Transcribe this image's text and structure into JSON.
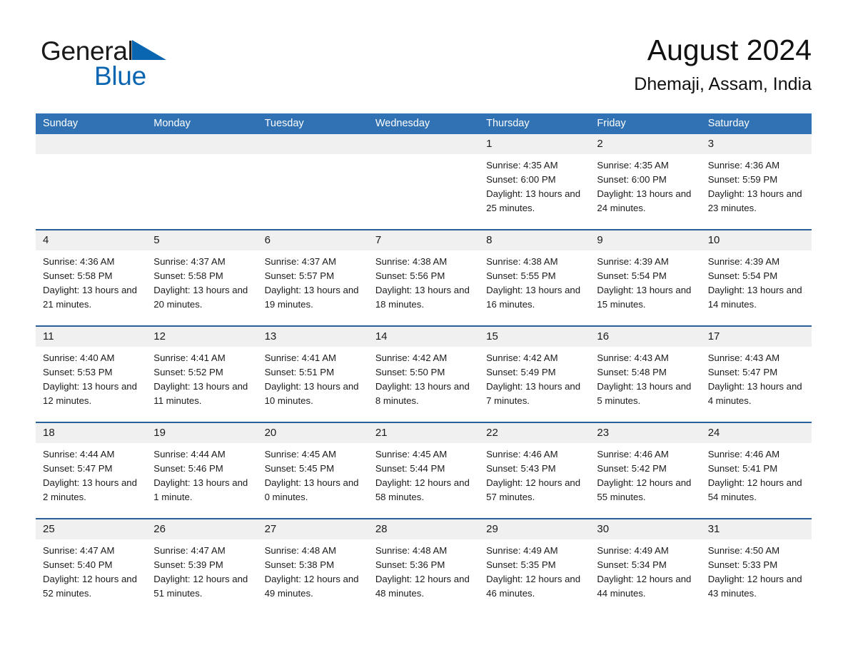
{
  "brand": {
    "word1": "General",
    "word2": "Blue",
    "triangle_color": "#0b66b2"
  },
  "header": {
    "title": "August 2024",
    "location": "Dhemaji, Assam, India"
  },
  "theme": {
    "header_blue": "#3072b3",
    "row_divider_blue": "#2a6099",
    "day_band_gray": "#f0f0f0",
    "text_color": "#1b1b1b"
  },
  "weekday_headers": [
    "Sunday",
    "Monday",
    "Tuesday",
    "Wednesday",
    "Thursday",
    "Friday",
    "Saturday"
  ],
  "weeks": [
    [
      {
        "day": "",
        "sunrise": "",
        "sunset": "",
        "daylight": "",
        "blank": true
      },
      {
        "day": "",
        "sunrise": "",
        "sunset": "",
        "daylight": "",
        "blank": true
      },
      {
        "day": "",
        "sunrise": "",
        "sunset": "",
        "daylight": "",
        "blank": true
      },
      {
        "day": "",
        "sunrise": "",
        "sunset": "",
        "daylight": "",
        "blank": true
      },
      {
        "day": "1",
        "sunrise": "Sunrise: 4:35 AM",
        "sunset": "Sunset: 6:00 PM",
        "daylight": "Daylight: 13 hours and 25 minutes."
      },
      {
        "day": "2",
        "sunrise": "Sunrise: 4:35 AM",
        "sunset": "Sunset: 6:00 PM",
        "daylight": "Daylight: 13 hours and 24 minutes."
      },
      {
        "day": "3",
        "sunrise": "Sunrise: 4:36 AM",
        "sunset": "Sunset: 5:59 PM",
        "daylight": "Daylight: 13 hours and 23 minutes."
      }
    ],
    [
      {
        "day": "4",
        "sunrise": "Sunrise: 4:36 AM",
        "sunset": "Sunset: 5:58 PM",
        "daylight": "Daylight: 13 hours and 21 minutes."
      },
      {
        "day": "5",
        "sunrise": "Sunrise: 4:37 AM",
        "sunset": "Sunset: 5:58 PM",
        "daylight": "Daylight: 13 hours and 20 minutes."
      },
      {
        "day": "6",
        "sunrise": "Sunrise: 4:37 AM",
        "sunset": "Sunset: 5:57 PM",
        "daylight": "Daylight: 13 hours and 19 minutes."
      },
      {
        "day": "7",
        "sunrise": "Sunrise: 4:38 AM",
        "sunset": "Sunset: 5:56 PM",
        "daylight": "Daylight: 13 hours and 18 minutes."
      },
      {
        "day": "8",
        "sunrise": "Sunrise: 4:38 AM",
        "sunset": "Sunset: 5:55 PM",
        "daylight": "Daylight: 13 hours and 16 minutes."
      },
      {
        "day": "9",
        "sunrise": "Sunrise: 4:39 AM",
        "sunset": "Sunset: 5:54 PM",
        "daylight": "Daylight: 13 hours and 15 minutes."
      },
      {
        "day": "10",
        "sunrise": "Sunrise: 4:39 AM",
        "sunset": "Sunset: 5:54 PM",
        "daylight": "Daylight: 13 hours and 14 minutes."
      }
    ],
    [
      {
        "day": "11",
        "sunrise": "Sunrise: 4:40 AM",
        "sunset": "Sunset: 5:53 PM",
        "daylight": "Daylight: 13 hours and 12 minutes."
      },
      {
        "day": "12",
        "sunrise": "Sunrise: 4:41 AM",
        "sunset": "Sunset: 5:52 PM",
        "daylight": "Daylight: 13 hours and 11 minutes."
      },
      {
        "day": "13",
        "sunrise": "Sunrise: 4:41 AM",
        "sunset": "Sunset: 5:51 PM",
        "daylight": "Daylight: 13 hours and 10 minutes."
      },
      {
        "day": "14",
        "sunrise": "Sunrise: 4:42 AM",
        "sunset": "Sunset: 5:50 PM",
        "daylight": "Daylight: 13 hours and 8 minutes."
      },
      {
        "day": "15",
        "sunrise": "Sunrise: 4:42 AM",
        "sunset": "Sunset: 5:49 PM",
        "daylight": "Daylight: 13 hours and 7 minutes."
      },
      {
        "day": "16",
        "sunrise": "Sunrise: 4:43 AM",
        "sunset": "Sunset: 5:48 PM",
        "daylight": "Daylight: 13 hours and 5 minutes."
      },
      {
        "day": "17",
        "sunrise": "Sunrise: 4:43 AM",
        "sunset": "Sunset: 5:47 PM",
        "daylight": "Daylight: 13 hours and 4 minutes."
      }
    ],
    [
      {
        "day": "18",
        "sunrise": "Sunrise: 4:44 AM",
        "sunset": "Sunset: 5:47 PM",
        "daylight": "Daylight: 13 hours and 2 minutes."
      },
      {
        "day": "19",
        "sunrise": "Sunrise: 4:44 AM",
        "sunset": "Sunset: 5:46 PM",
        "daylight": "Daylight: 13 hours and 1 minute."
      },
      {
        "day": "20",
        "sunrise": "Sunrise: 4:45 AM",
        "sunset": "Sunset: 5:45 PM",
        "daylight": "Daylight: 13 hours and 0 minutes."
      },
      {
        "day": "21",
        "sunrise": "Sunrise: 4:45 AM",
        "sunset": "Sunset: 5:44 PM",
        "daylight": "Daylight: 12 hours and 58 minutes."
      },
      {
        "day": "22",
        "sunrise": "Sunrise: 4:46 AM",
        "sunset": "Sunset: 5:43 PM",
        "daylight": "Daylight: 12 hours and 57 minutes."
      },
      {
        "day": "23",
        "sunrise": "Sunrise: 4:46 AM",
        "sunset": "Sunset: 5:42 PM",
        "daylight": "Daylight: 12 hours and 55 minutes."
      },
      {
        "day": "24",
        "sunrise": "Sunrise: 4:46 AM",
        "sunset": "Sunset: 5:41 PM",
        "daylight": "Daylight: 12 hours and 54 minutes."
      }
    ],
    [
      {
        "day": "25",
        "sunrise": "Sunrise: 4:47 AM",
        "sunset": "Sunset: 5:40 PM",
        "daylight": "Daylight: 12 hours and 52 minutes."
      },
      {
        "day": "26",
        "sunrise": "Sunrise: 4:47 AM",
        "sunset": "Sunset: 5:39 PM",
        "daylight": "Daylight: 12 hours and 51 minutes."
      },
      {
        "day": "27",
        "sunrise": "Sunrise: 4:48 AM",
        "sunset": "Sunset: 5:38 PM",
        "daylight": "Daylight: 12 hours and 49 minutes."
      },
      {
        "day": "28",
        "sunrise": "Sunrise: 4:48 AM",
        "sunset": "Sunset: 5:36 PM",
        "daylight": "Daylight: 12 hours and 48 minutes."
      },
      {
        "day": "29",
        "sunrise": "Sunrise: 4:49 AM",
        "sunset": "Sunset: 5:35 PM",
        "daylight": "Daylight: 12 hours and 46 minutes."
      },
      {
        "day": "30",
        "sunrise": "Sunrise: 4:49 AM",
        "sunset": "Sunset: 5:34 PM",
        "daylight": "Daylight: 12 hours and 44 minutes."
      },
      {
        "day": "31",
        "sunrise": "Sunrise: 4:50 AM",
        "sunset": "Sunset: 5:33 PM",
        "daylight": "Daylight: 12 hours and 43 minutes."
      }
    ]
  ]
}
